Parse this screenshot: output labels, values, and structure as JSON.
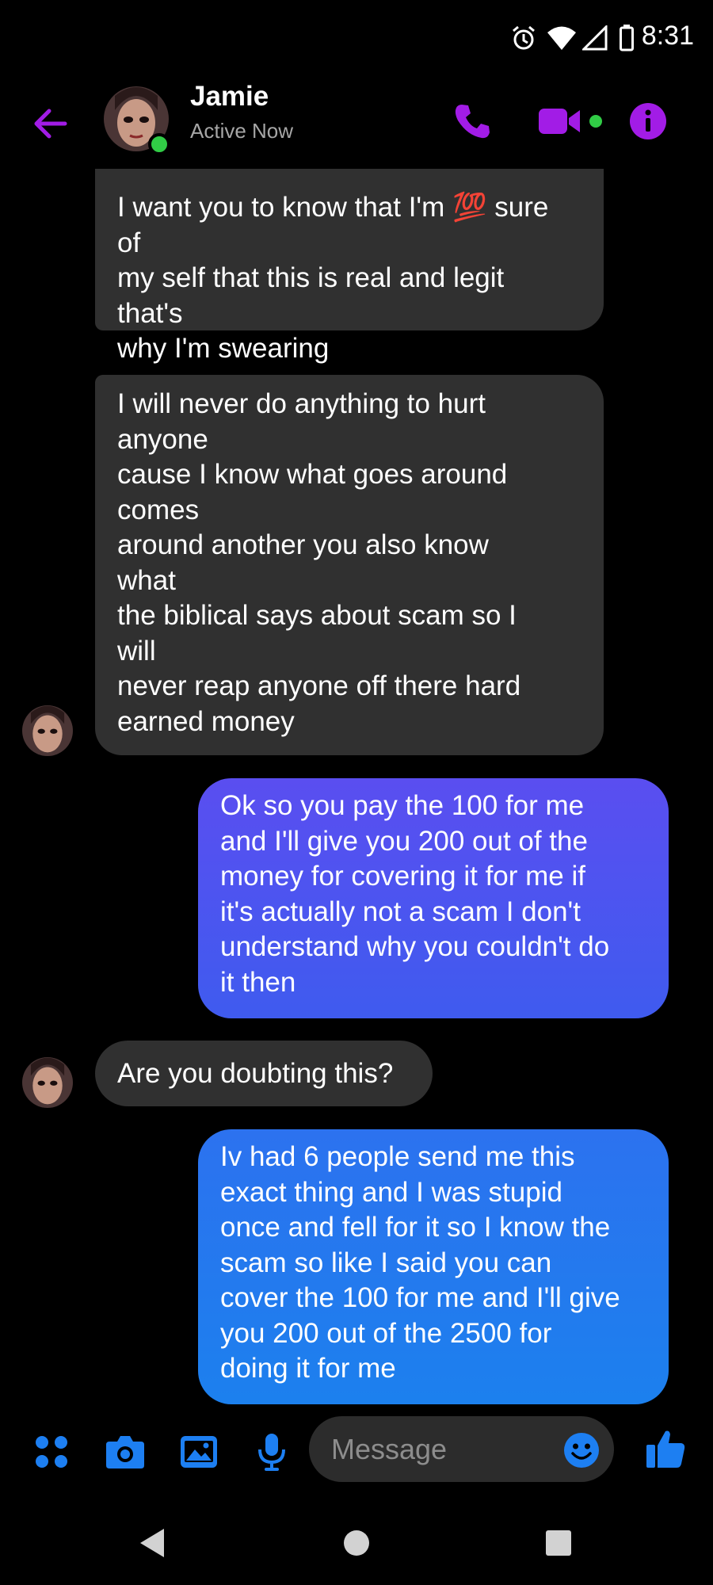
{
  "status_bar": {
    "time": "8:31",
    "icons": [
      "alarm-icon",
      "wifi-icon",
      "signal-icon",
      "battery-icon"
    ]
  },
  "header": {
    "contact_name": "Jamie",
    "contact_status": "Active Now",
    "accent_color": "#a21ce6",
    "online_color": "#31cc46",
    "actions": [
      "phone-call-icon",
      "video-call-icon",
      "info-icon"
    ]
  },
  "messages": [
    {
      "direction": "incoming",
      "text": "I want you to know that I'm 💯 sure\nof\nmy self that this is real and legit\nthat's\nwhy I'm swearing"
    },
    {
      "direction": "incoming",
      "text": "I will never do anything to hurt\nanyone\ncause I know what goes around\ncomes\naround another you also know\nwhat\nthe biblical says about scam so I\nwill\nnever reap anyone off there hard\nearned money"
    },
    {
      "direction": "outgoing",
      "text": "Ok so you pay the 100 for me\nand I'll give you 200 out of the\nmoney for covering it for me if\nit's actually not a scam I don't\nunderstand why you couldn't do\nit then"
    },
    {
      "direction": "incoming",
      "text": "Are you doubting this?"
    },
    {
      "direction": "outgoing",
      "text": "Iv had 6 people send me this\nexact thing and I was stupid\nonce and fell for it so I know the\nscam so like I said you can\ncover the 100 for me and I'll give\nyou  200 out of the 2500 for\ndoing it for me"
    }
  ],
  "composer": {
    "placeholder": "Message",
    "tools": [
      "apps-grid-icon",
      "camera-icon",
      "gallery-icon",
      "microphone-icon"
    ],
    "emoji_icon": "emoji-icon",
    "like_icon": "thumbs-up-icon",
    "accent_color": "#1d7ff2"
  },
  "navigation": [
    "back-nav-icon",
    "home-nav-icon",
    "recents-nav-icon"
  ],
  "colors": {
    "incoming_bubble": "#303030",
    "outgoing_gradient_top": "#5a4ef0",
    "outgoing_gradient_bottom": "#1c80ee"
  }
}
